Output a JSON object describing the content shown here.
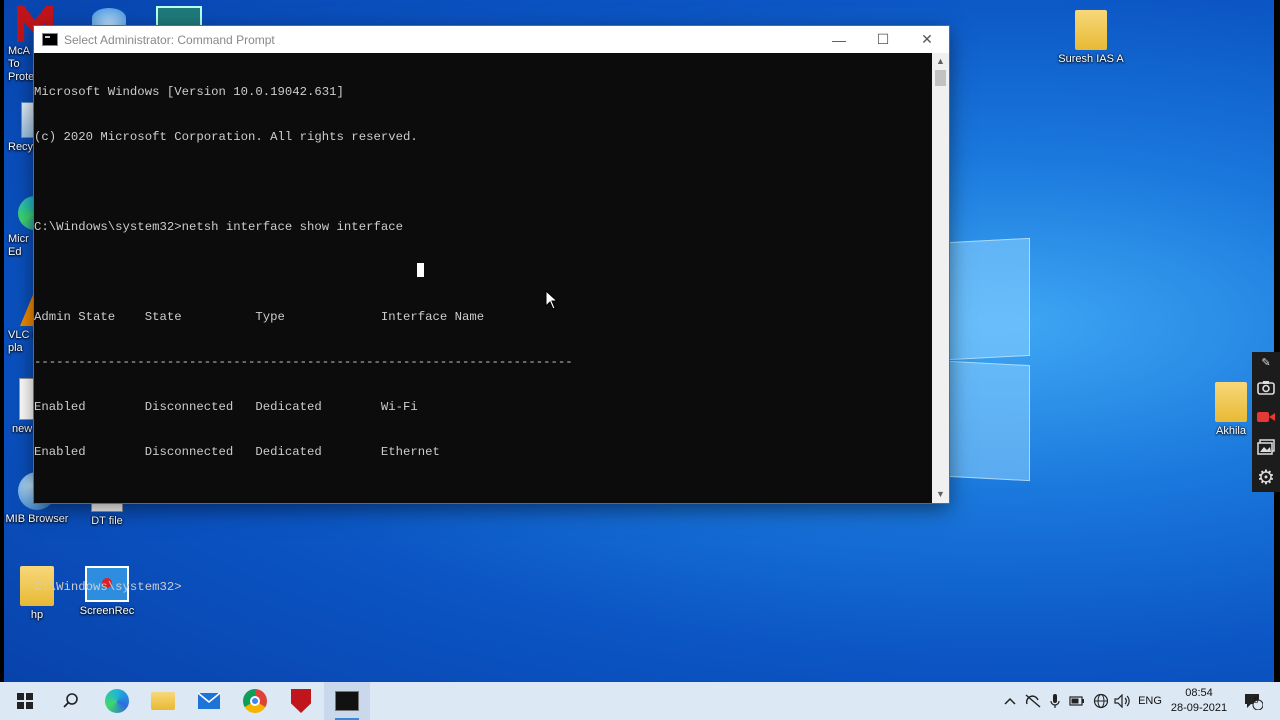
{
  "desktop": {
    "icons_left": [
      {
        "label": "McA\nTo\nProte"
      },
      {
        "label": "Recyc"
      },
      {
        "label": "Micr\nEd"
      },
      {
        "label": "VLC n\npla"
      },
      {
        "label": "new"
      },
      {
        "label": "MIB Browser"
      },
      {
        "label": "DT file"
      },
      {
        "label": "hp"
      },
      {
        "label": "ScreenRec"
      }
    ],
    "icon_suresh": "Suresh IAS A",
    "icon_akhila": "Akhila"
  },
  "window": {
    "title": "Select Administrator: Command Prompt",
    "minimize": "—",
    "maximize": "☐",
    "close": "✕"
  },
  "console": {
    "lines": [
      "Microsoft Windows [Version 10.0.19042.631]",
      "(c) 2020 Microsoft Corporation. All rights reserved.",
      "",
      "C:\\Windows\\system32>netsh interface show interface",
      "",
      "Admin State    State          Type             Interface Name",
      "-------------------------------------------------------------------------",
      "Enabled        Disconnected   Dedicated        Wi-Fi",
      "Enabled        Disconnected   Dedicated        Ethernet",
      "",
      "",
      "C:\\Windows\\system32>"
    ]
  },
  "recorder_toolbar": {
    "icons": [
      "pin-icon",
      "camera-icon",
      "video-icon",
      "gallery-icon",
      "settings-icon"
    ]
  },
  "taskbar": {
    "language": "ENG",
    "time": "08:54",
    "date": "28-09-2021",
    "notification_count": "5",
    "colors": {
      "accent": "#3a86d8",
      "background": "#dde8f5"
    }
  }
}
